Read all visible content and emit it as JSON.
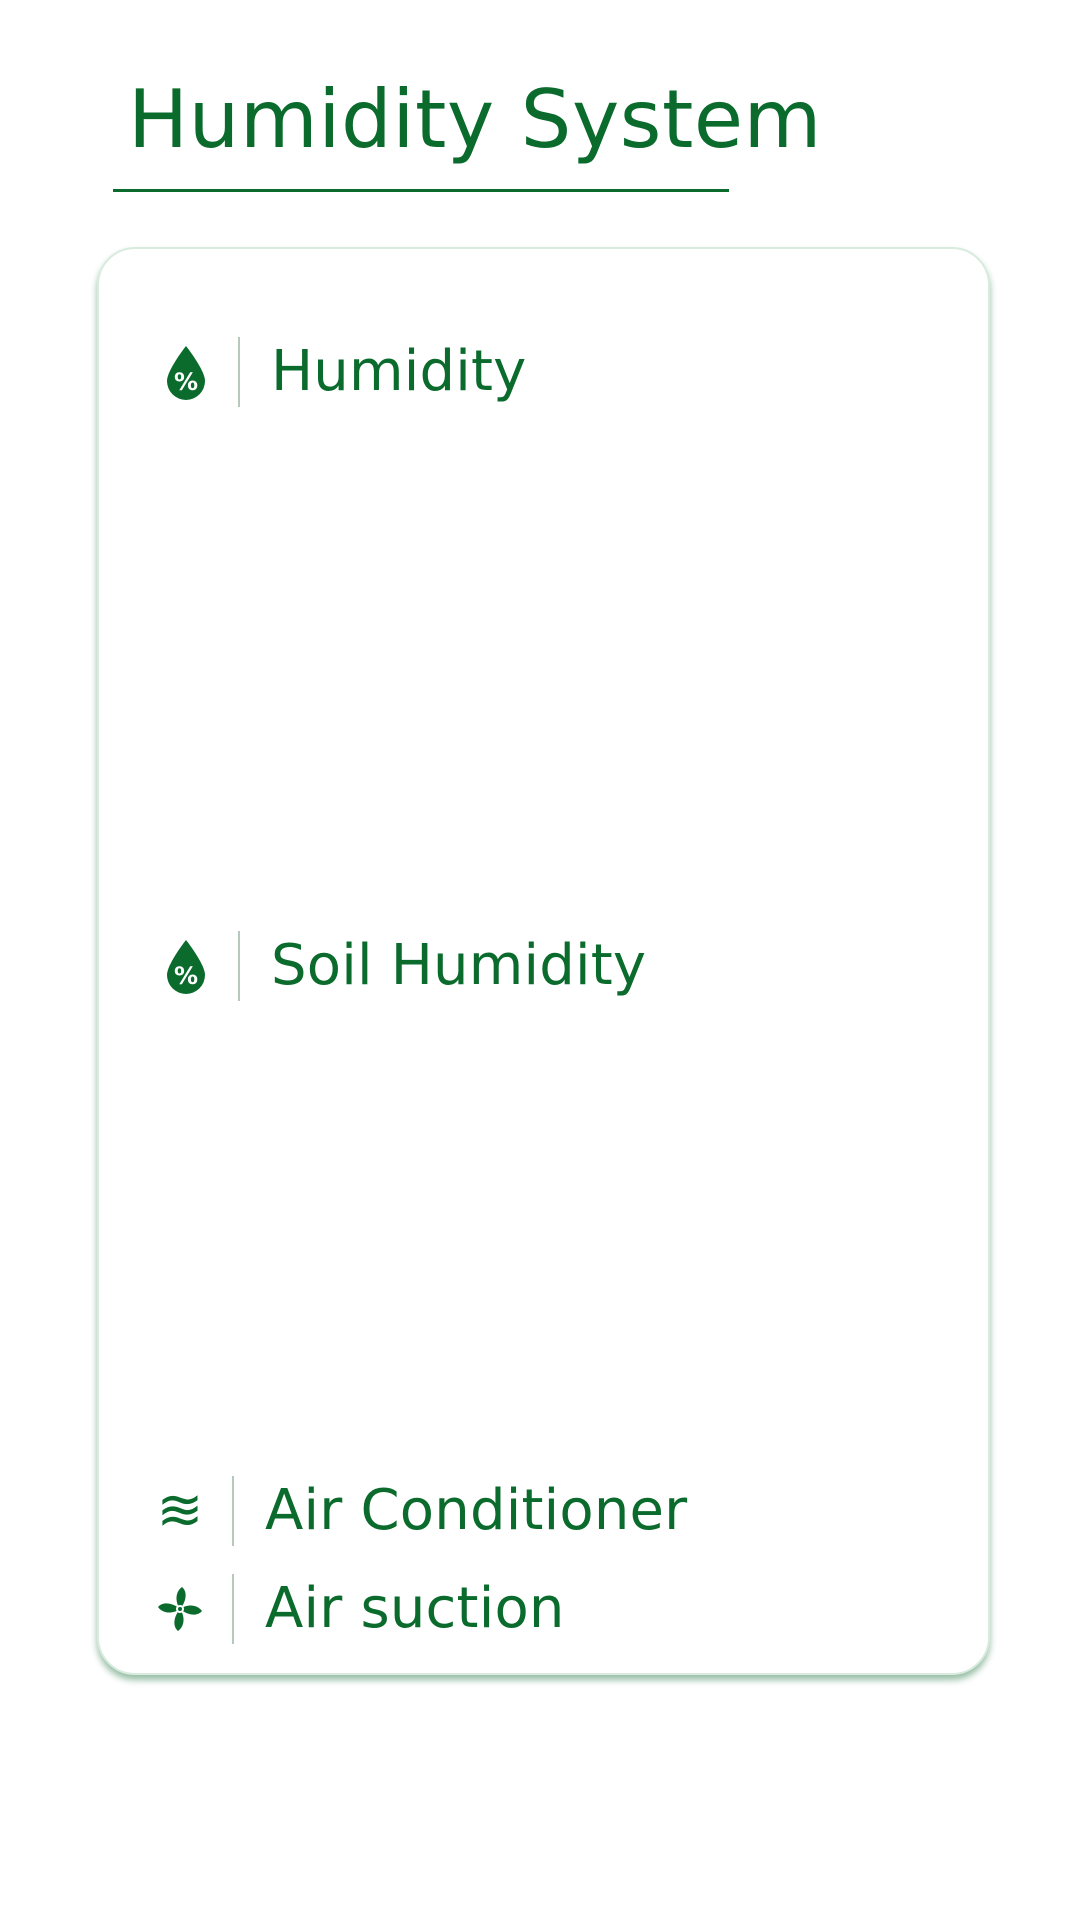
{
  "header": {
    "title": "Humidity System"
  },
  "card": {
    "rows": [
      {
        "label": "Humidity",
        "icon": "humidity-drop-icon"
      },
      {
        "label": "Soil Humidity",
        "icon": "humidity-drop-icon"
      },
      {
        "label": "Air Conditioner",
        "icon": "waves-icon",
        "glyph": "≋"
      },
      {
        "label": "Air suction",
        "icon": "fan-icon"
      }
    ]
  },
  "colors": {
    "accent": "#0a6b2c",
    "divider": "#b7c8bd",
    "card_border": "#d8ebde"
  }
}
